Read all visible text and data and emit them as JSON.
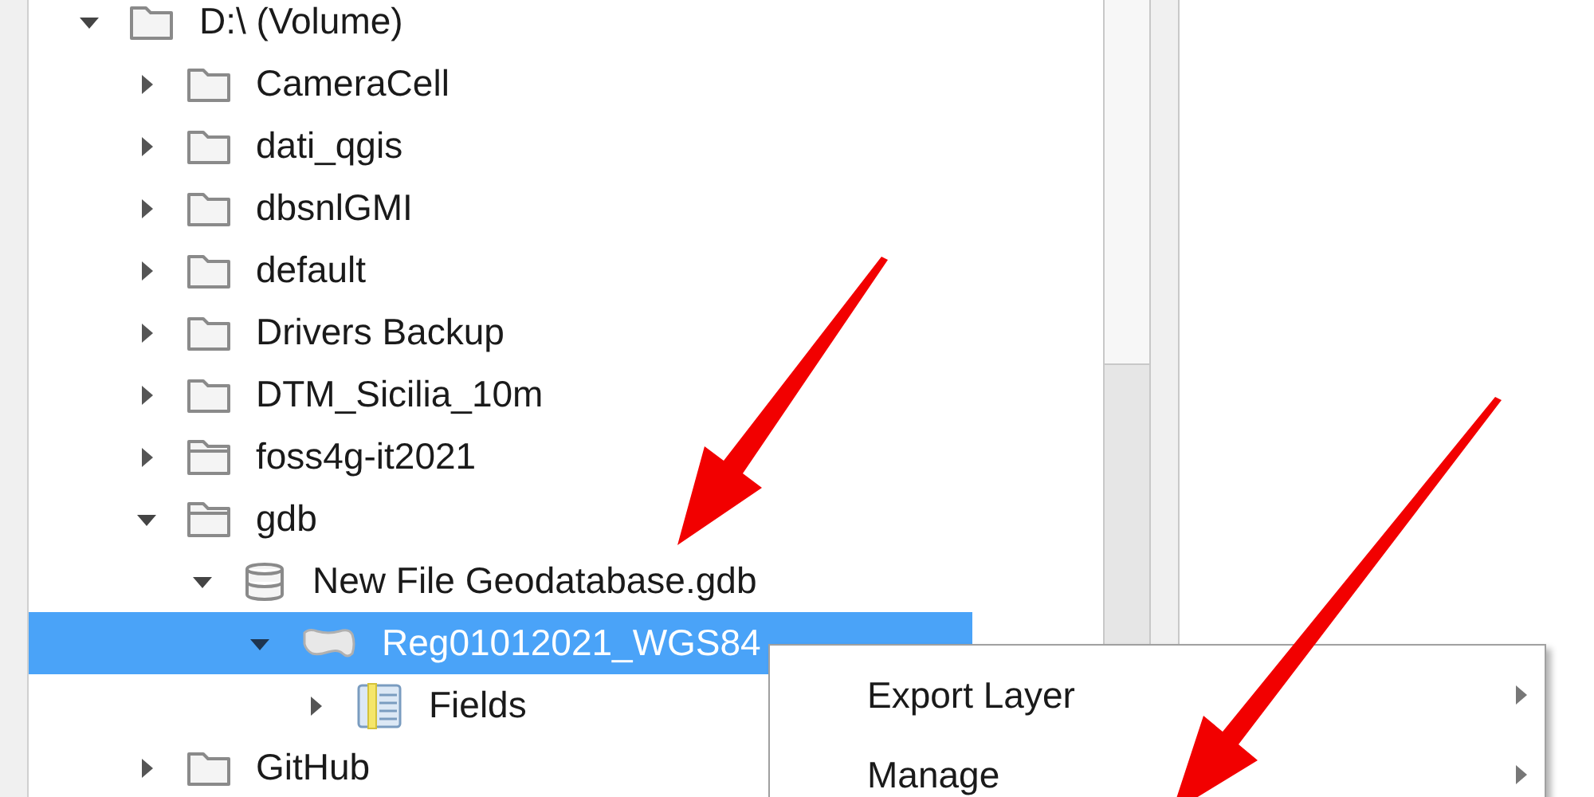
{
  "tree": [
    {
      "label": "D:\\ (Volume)",
      "kind": "drive",
      "expanded": true,
      "selected": false,
      "children": [
        {
          "label": "CameraCell",
          "kind": "folder",
          "expanded": false,
          "selected": false
        },
        {
          "label": "dati_qgis",
          "kind": "folder",
          "expanded": false,
          "selected": false
        },
        {
          "label": "dbsnlGMI",
          "kind": "folder",
          "expanded": false,
          "selected": false
        },
        {
          "label": "default",
          "kind": "folder",
          "expanded": false,
          "selected": false
        },
        {
          "label": "Drivers Backup",
          "kind": "folder",
          "expanded": false,
          "selected": false
        },
        {
          "label": "DTM_Sicilia_10m",
          "kind": "folder",
          "expanded": false,
          "selected": false
        },
        {
          "label": "foss4g-it2021",
          "kind": "project",
          "expanded": false,
          "selected": false
        },
        {
          "label": "gdb",
          "kind": "project",
          "expanded": true,
          "selected": false,
          "children": [
            {
              "label": "New File Geodatabase.gdb",
              "kind": "database",
              "expanded": true,
              "selected": false,
              "children": [
                {
                  "label": "Reg01012021_WGS84",
                  "kind": "layer",
                  "expanded": true,
                  "selected": true,
                  "children": [
                    {
                      "label": "Fields",
                      "kind": "table",
                      "expanded": false,
                      "selected": false
                    }
                  ]
                }
              ]
            }
          ]
        },
        {
          "label": "GitHub",
          "kind": "folder",
          "expanded": false,
          "selected": false
        }
      ]
    }
  ],
  "context_menu": {
    "items": [
      {
        "label": "Export Layer",
        "has_submenu": true
      },
      {
        "label": "Manage",
        "has_submenu": true
      }
    ]
  }
}
